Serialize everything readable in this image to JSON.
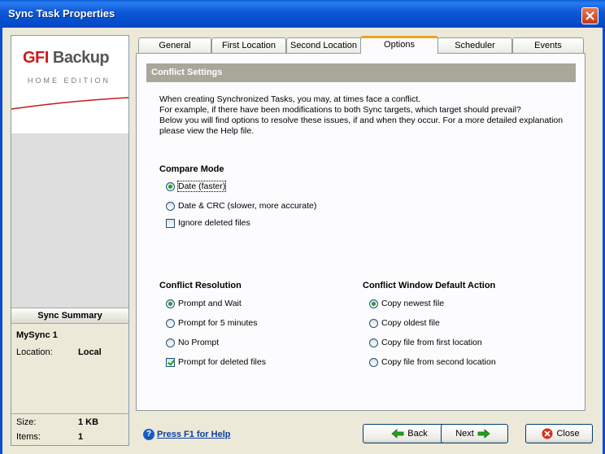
{
  "window": {
    "title": "Sync Task Properties"
  },
  "logo": {
    "brand_gfi": "GFI",
    "brand_backup": "Backup",
    "edition": "HOME EDITION"
  },
  "summary": {
    "header": "Sync Summary",
    "name": "MySync 1",
    "location_label": "Location:",
    "location_value": "Local",
    "size_label": "Size:",
    "size_value": "1 KB",
    "items_label": "Items:",
    "items_value": "1"
  },
  "tabs": [
    {
      "label": "General",
      "active": false
    },
    {
      "label": "First Location",
      "active": false
    },
    {
      "label": "Second Location",
      "active": false
    },
    {
      "label": "Options",
      "active": true
    },
    {
      "label": "Scheduler",
      "active": false
    },
    {
      "label": "Events",
      "active": false
    }
  ],
  "section": {
    "title": "Conflict Settings"
  },
  "description": [
    "When creating Synchronized Tasks, you may, at times face a conflict.",
    "For example, if there have been modifications to both Sync targets, which target should prevail?",
    "Below you will find options to resolve these issues, if and when they occur. For a more detailed explanation",
    "please view the Help file."
  ],
  "compare_mode": {
    "title": "Compare Mode",
    "options": [
      {
        "label": "Date (faster)",
        "checked": true
      },
      {
        "label": "Date & CRC (slower, more accurate)",
        "checked": false
      }
    ],
    "ignore_deleted": {
      "label": "Ignore deleted files",
      "checked": false
    }
  },
  "conflict_resolution": {
    "title": "Conflict Resolution",
    "options": [
      {
        "label": "Prompt and Wait",
        "checked": true
      },
      {
        "label": "Prompt for 5 minutes",
        "checked": false
      },
      {
        "label": "No Prompt",
        "checked": false
      }
    ],
    "prompt_deleted": {
      "label": "Prompt for deleted files",
      "checked": true
    }
  },
  "default_action": {
    "title": "Conflict Window Default Action",
    "options": [
      {
        "label": "Copy newest file",
        "checked": true
      },
      {
        "label": "Copy oldest file",
        "checked": false
      },
      {
        "label": "Copy file from first location",
        "checked": false
      },
      {
        "label": "Copy file from second location",
        "checked": false
      }
    ]
  },
  "footer": {
    "help_label": "Press F1 for Help",
    "back_label": "Back",
    "next_label": "Next",
    "close_label": "Close"
  }
}
